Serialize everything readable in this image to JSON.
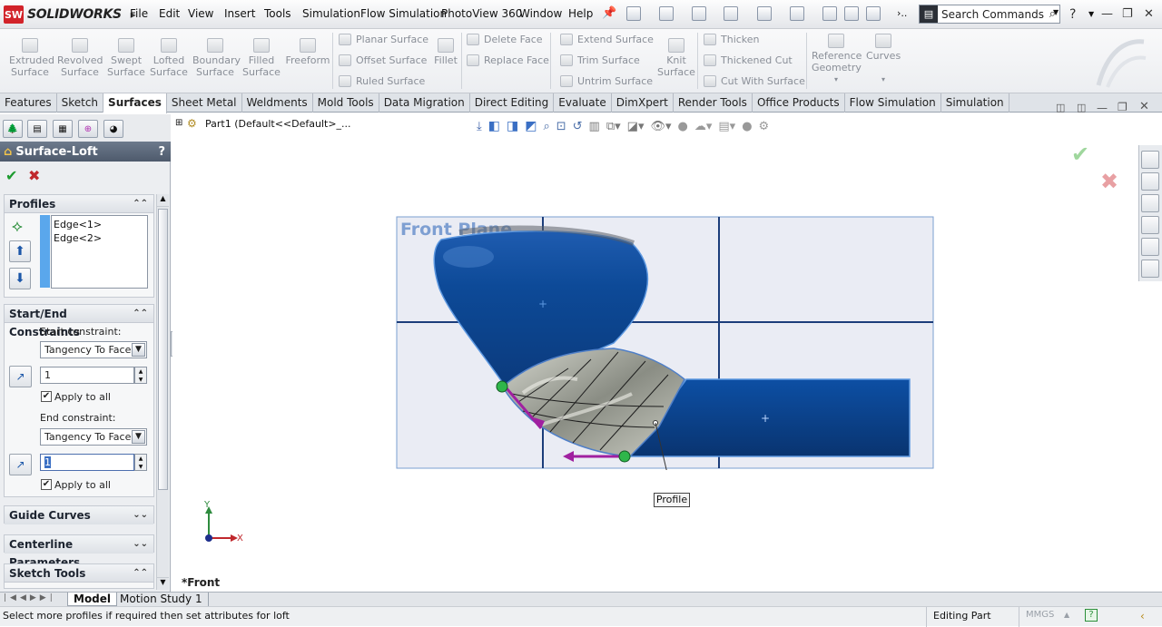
{
  "app": {
    "name": "SOLIDWORKS"
  },
  "menu": [
    "File",
    "Edit",
    "View",
    "Insert",
    "Tools",
    "Simulation",
    "Flow Simulation",
    "PhotoView 360",
    "Window",
    "Help"
  ],
  "search": {
    "placeholder": "Search Commands"
  },
  "ribbon": {
    "large_buttons": [
      {
        "label1": "Extruded",
        "label2": "Surface"
      },
      {
        "label1": "Revolved",
        "label2": "Surface"
      },
      {
        "label1": "Swept",
        "label2": "Surface"
      },
      {
        "label1": "Lofted",
        "label2": "Surface"
      },
      {
        "label1": "Boundary",
        "label2": "Surface"
      },
      {
        "label1": "Filled",
        "label2": "Surface"
      },
      {
        "label1": "Freeform",
        "label2": ""
      }
    ],
    "group1": [
      "Planar Surface",
      "Offset Surface",
      "Ruled Surface"
    ],
    "fillet": "Fillet",
    "group2": [
      "Delete Face",
      "Replace Face"
    ],
    "group3": [
      "Extend Surface",
      "Trim Surface",
      "Untrim Surface"
    ],
    "knit": {
      "label1": "Knit",
      "label2": "Surface"
    },
    "group4": [
      "Thicken",
      "Thickened Cut",
      "Cut With Surface"
    ],
    "reference": {
      "label1": "Reference",
      "label2": "Geometry"
    },
    "curves": "Curves"
  },
  "tabs": [
    "Features",
    "Sketch",
    "Surfaces",
    "Sheet Metal",
    "Weldments",
    "Mold Tools",
    "Data Migration",
    "Direct Editing",
    "Evaluate",
    "DimXpert",
    "Render Tools",
    "Office Products",
    "Flow Simulation",
    "Simulation"
  ],
  "active_tab": "Surfaces",
  "tree": {
    "part_label": "Part1  (Default<<Default>_..."
  },
  "property_manager": {
    "title": "Surface-Loft",
    "help": "?",
    "profiles": {
      "header": "Profiles",
      "items": [
        "Edge<1>",
        "Edge<2>"
      ]
    },
    "constraints": {
      "header": "Start/End Constraints",
      "start_label": "Start constraint:",
      "start_value": "Tangency To Face",
      "start_length": "1",
      "apply_all_1": "Apply to all",
      "end_label": "End constraint:",
      "end_value": "Tangency To Face",
      "end_length": "1",
      "apply_all_2": "Apply to all"
    },
    "guide_curves": "Guide Curves",
    "centerline": "Centerline Parameters",
    "sketch_tools": "Sketch Tools"
  },
  "viewport": {
    "plane_label": "Front Plane",
    "profile_callout": "Profile",
    "view_name": "*Front",
    "axis_y": "Y",
    "axis_x": "X"
  },
  "bottom_tabs": [
    "Model",
    "Motion Study 1"
  ],
  "status": {
    "message": "Select more profiles if required then set attributes for loft",
    "editing": "Editing Part",
    "units": "MMGS"
  }
}
